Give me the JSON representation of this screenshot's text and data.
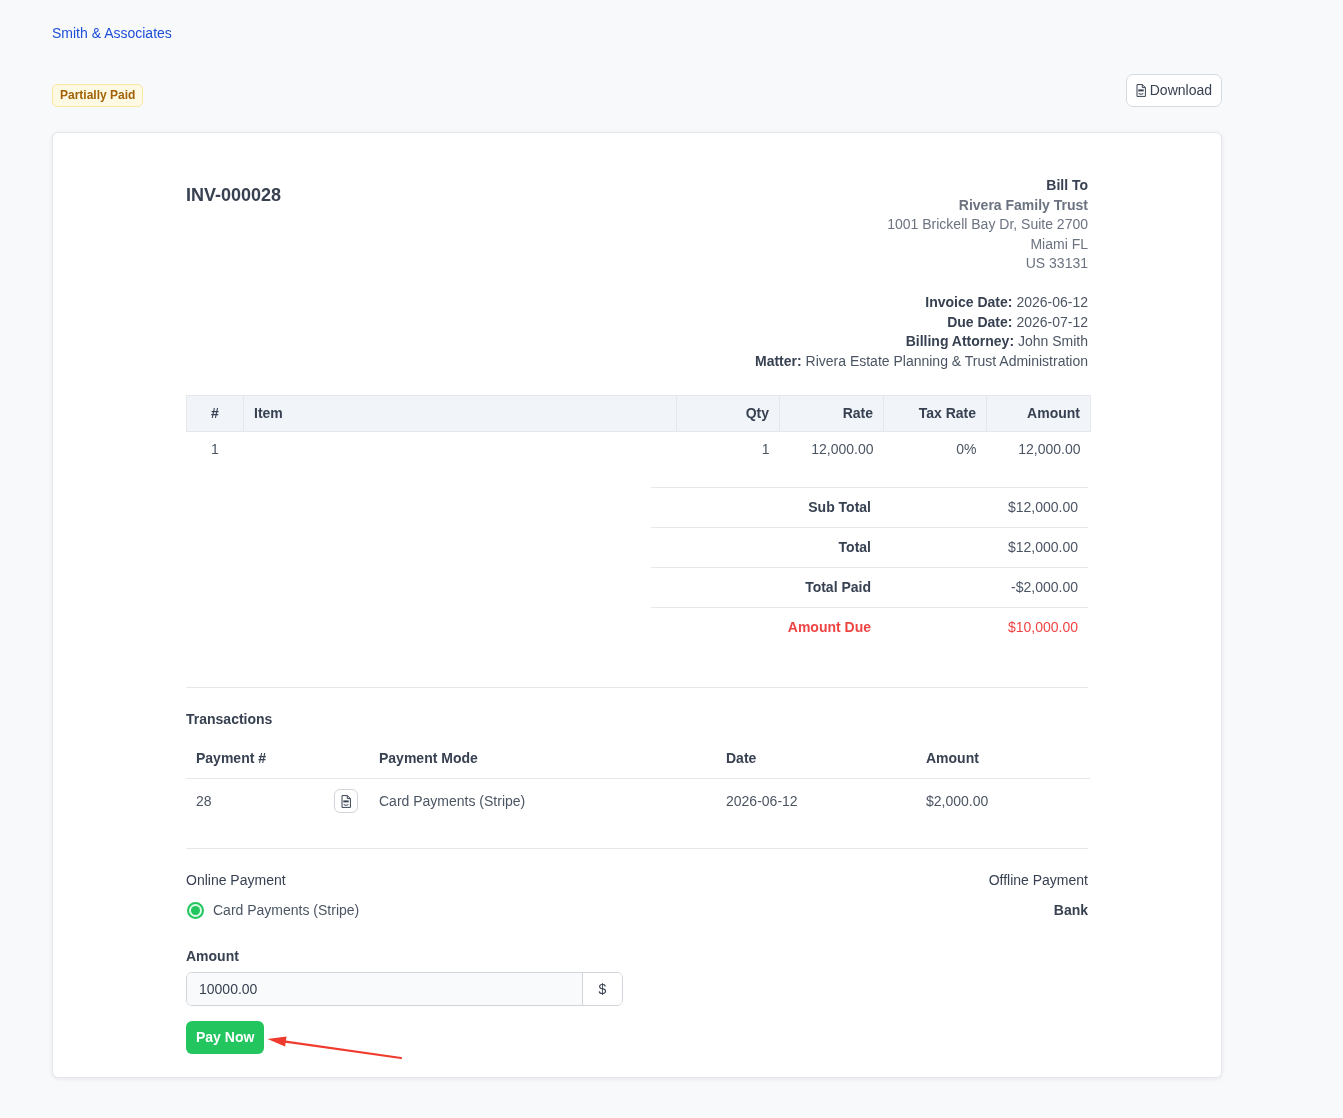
{
  "header": {
    "brand": "Smith & Associates",
    "status_badge": {
      "label": "Partially Paid",
      "kind": "warning"
    },
    "download_button": {
      "label": "Download"
    }
  },
  "invoice": {
    "number": "INV-000028",
    "bill_to": {
      "heading": "Bill To",
      "name": "Rivera Family Trust",
      "address_lines": [
        "1001 Brickell Bay Dr, Suite 2700",
        "Miami FL",
        "US 33131"
      ]
    },
    "details": [
      {
        "label": "Invoice Date:",
        "value": "2026-06-12"
      },
      {
        "label": "Due Date:",
        "value": "2026-07-12"
      },
      {
        "label": "Billing Attorney:",
        "value": "John Smith"
      },
      {
        "label": "Matter:",
        "value": "Rivera Estate Planning & Trust Administration"
      }
    ]
  },
  "items_table": {
    "columns": [
      "#",
      "Item",
      "Qty",
      "Rate",
      "Tax Rate",
      "Amount"
    ],
    "rows": [
      {
        "number": "1",
        "qty": "1",
        "rate": "12,000.00",
        "tax_rate": "0%",
        "amount": "12,000.00"
      }
    ]
  },
  "totals": [
    {
      "label": "Sub Total",
      "value": "$12,000.00",
      "kind": "normal"
    },
    {
      "label": "Total",
      "value": "$12,000.00",
      "kind": "normal"
    },
    {
      "label": "Total Paid",
      "value": "-$2,000.00",
      "kind": "normal"
    },
    {
      "label": "Amount Due",
      "value": "$10,000.00",
      "kind": "due"
    }
  ],
  "transactions": {
    "title": "Transactions",
    "columns": [
      "Payment #",
      "Payment Mode",
      "Date",
      "Amount"
    ],
    "rows": [
      {
        "payment_number": "28",
        "document_button": true,
        "mode": "Card Payments (Stripe)",
        "date": "2026-06-12",
        "amount": "$2,000.00"
      }
    ]
  },
  "payment": {
    "online": {
      "heading": "Online Payment",
      "methods": [
        {
          "label": "Card Payments (Stripe)",
          "selected": true
        }
      ]
    },
    "offline": {
      "heading": "Offline Payment",
      "methods": [
        "Bank"
      ]
    },
    "amount": {
      "label": "Amount",
      "value": "10000.00",
      "addon": "$"
    },
    "pay_button": {
      "label": "Pay Now",
      "annotation_arrow": true
    }
  }
}
